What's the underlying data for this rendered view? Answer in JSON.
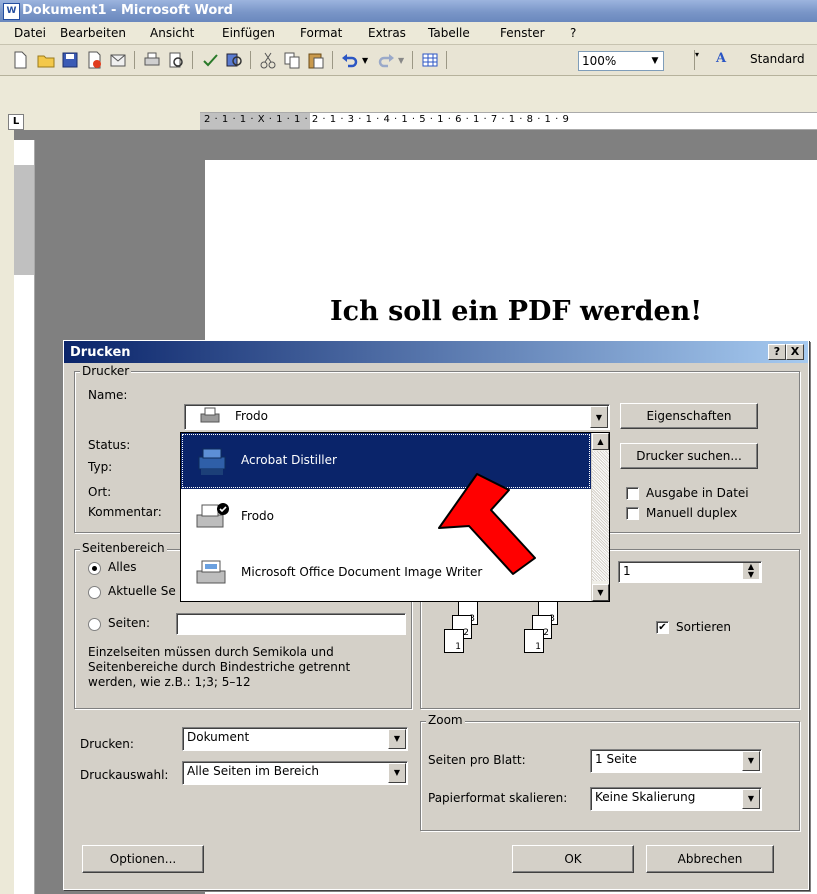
{
  "window": {
    "title": "Dokument1 - Microsoft Word"
  },
  "menu": [
    "Datei",
    "Bearbeiten",
    "Ansicht",
    "Einfügen",
    "Format",
    "Extras",
    "Tabelle",
    "Fenster",
    "?"
  ],
  "toolbar": {
    "zoom": "100%",
    "style": "Standard"
  },
  "ruler": {
    "numbers": "2 · 1 · 1 · X · 1 · 1 · 2 · 1 · 3 · 1 · 4 · 1 · 5 · 1 · 6 · 1 · 7 · 1 · 8 · 1 · 9"
  },
  "document": {
    "text": "Ich soll ein PDF werden!"
  },
  "dialog": {
    "title": "Drucken",
    "help_btn": "?",
    "close_btn": "X",
    "printer_group": "Drucker",
    "name_label": "Name:",
    "name_value": "Frodo",
    "status_label": "Status:",
    "type_label": "Typ:",
    "location_label": "Ort:",
    "comment_label": "Kommentar:",
    "properties_btn": "Eigenschaften",
    "find_printer_btn": "Drucker suchen...",
    "print_to_file": "Ausgabe in Datei",
    "manual_duplex": "Manuell duplex",
    "printer_list": [
      "Acrobat Distiller",
      "Frodo",
      "Microsoft Office Document Image Writer"
    ],
    "range_group": "Seitenbereich",
    "range_all": "Alles",
    "range_current": "Aktuelle Se",
    "range_pages": "Seiten:",
    "range_hint": "Einzelseiten müssen durch Semikola und Seitenbereiche durch Bindestriche getrennt werden, wie z.B.: 1;3; 5–12",
    "copies_value": "1",
    "collate": "Sortieren",
    "print_label": "Drucken:",
    "print_value": "Dokument",
    "print_selection_label": "Druckauswahl:",
    "print_selection_value": "Alle Seiten im Bereich",
    "zoom_group": "Zoom",
    "pages_per_sheet_label": "Seiten pro Blatt:",
    "pages_per_sheet_value": "1 Seite",
    "scale_label": "Papierformat skalieren:",
    "scale_value": "Keine Skalierung",
    "options_btn": "Optionen...",
    "ok_btn": "OK",
    "cancel_btn": "Abbrechen"
  },
  "colors": {
    "selection": "#0a246a",
    "arrow": "#ff0000",
    "dialog_bg": "#d4d0c8"
  }
}
